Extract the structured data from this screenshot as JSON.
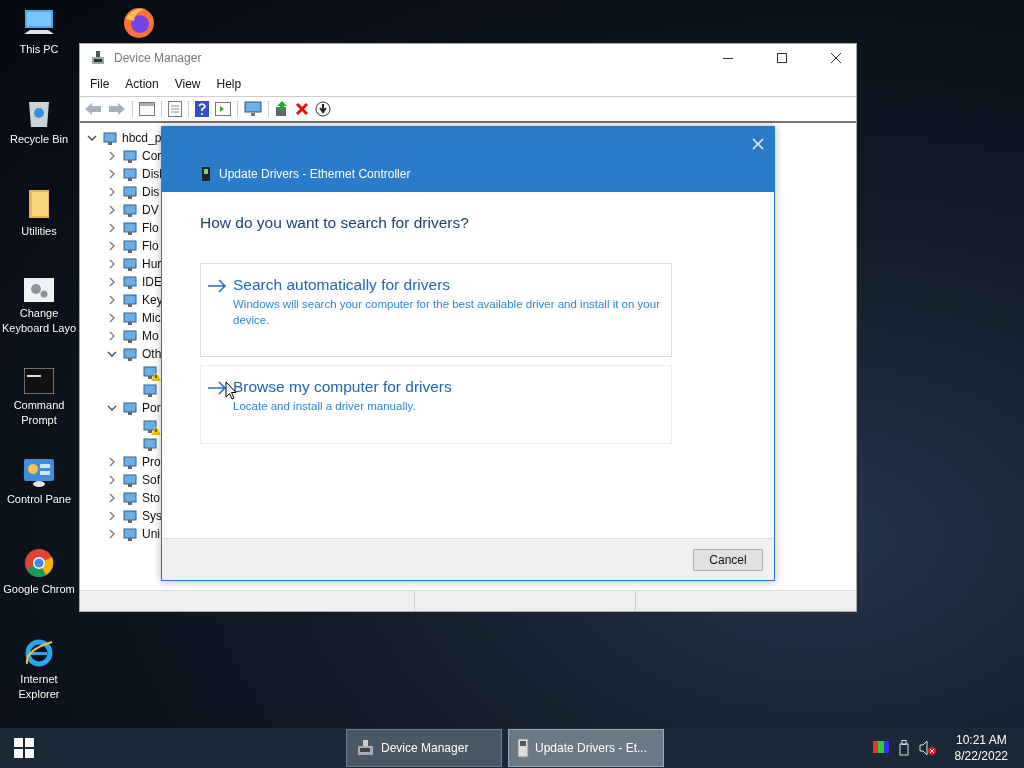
{
  "desktop_icons": [
    {
      "kind": "pc",
      "label": "This PC"
    },
    {
      "kind": "recycle",
      "label": "Recycle Bin"
    },
    {
      "kind": "folder",
      "label": "Utilities"
    },
    {
      "kind": "keyboard-settings",
      "label": "Change Keyboard Layo"
    },
    {
      "kind": "cmd",
      "label": "Command Prompt"
    },
    {
      "kind": "control",
      "label": "Control Pane"
    },
    {
      "kind": "chrome",
      "label": "Google Chrom"
    },
    {
      "kind": "ie",
      "label": "Internet Explorer"
    }
  ],
  "desktop_top_icons": [
    {
      "kind": "firefox"
    }
  ],
  "device_manager": {
    "title": "Device Manager",
    "menu": [
      "File",
      "Action",
      "View",
      "Help"
    ],
    "tree": {
      "label": "hbcd_p",
      "expanded": true,
      "children": [
        {
          "label": "Cor",
          "expanded": false
        },
        {
          "label": "Disl",
          "expanded": false
        },
        {
          "label": "Dis",
          "expanded": false
        },
        {
          "label": "DV",
          "expanded": false
        },
        {
          "label": "Flo",
          "expanded": false
        },
        {
          "label": "Flo",
          "expanded": false
        },
        {
          "label": "Hur",
          "expanded": false
        },
        {
          "label": "IDE",
          "expanded": false
        },
        {
          "label": "Key",
          "expanded": false
        },
        {
          "label": "Mic",
          "expanded": false
        },
        {
          "label": "Mo",
          "expanded": false
        },
        {
          "label": "Oth",
          "expanded": true,
          "children": [
            {
              "warning": true
            },
            {
              "warning": false
            }
          ]
        },
        {
          "label": "Por",
          "expanded": true,
          "children": [
            {
              "warning": true
            },
            {
              "warning": false
            }
          ]
        },
        {
          "label": "Pro",
          "expanded": false
        },
        {
          "label": "Sof",
          "expanded": false
        },
        {
          "label": "Sto",
          "expanded": false
        },
        {
          "label": "Sys",
          "expanded": false
        },
        {
          "label": "Uni",
          "expanded": false
        }
      ]
    }
  },
  "dialog": {
    "title": "Update Drivers - Ethernet Controller",
    "heading": "How do you want to search for drivers?",
    "options": [
      {
        "title": "Search automatically for drivers",
        "description": "Windows will search your computer for the best available driver and install it on your device."
      },
      {
        "title": "Browse my computer for drivers",
        "description": "Locate and install a driver manually."
      }
    ],
    "cancel": "Cancel"
  },
  "taskbar": {
    "buttons": [
      {
        "label": "Device Manager",
        "selected": false
      },
      {
        "label": "Update Drivers - Et...",
        "selected": true
      }
    ],
    "volume_muted": true,
    "time": "10:21 AM",
    "date": "8/22/2022"
  }
}
